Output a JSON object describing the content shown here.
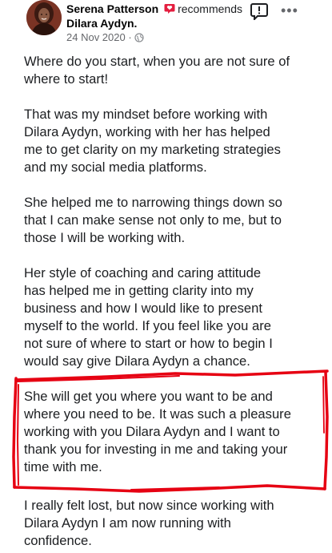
{
  "post": {
    "author": "Serena Patterson",
    "action": "recommends",
    "recommended": "Dilara Aydyn.",
    "date": "24 Nov 2020",
    "date_separator": "·",
    "icons": {
      "recommend": "recommend-badge-icon",
      "report": "report-icon",
      "more": "more-options-icon",
      "audience": "public-globe-icon"
    },
    "more_label": "•••",
    "paragraphs": [
      "Where do you start, when you are not sure of\nwhere to start!",
      "That was my mindset before working with\nDilara Aydyn, working with her has helped\nme to get clarity on my marketing strategies\nand my social media platforms.",
      "She helped me to narrowing things down so\nthat I can make sense not only to me, but to\nthose I will be working with.",
      "Her style of coaching and caring attitude\nhas helped me in getting clarity into my\nbusiness and how I would like to present\nmyself to the world. If you feel like you are\nnot sure of where to start or how to begin I\nwould say give Dilara Aydyn a chance.",
      "She will get you where you want to be and\nwhere you need to be. It was such a pleasure\nworking with you Dilara Aydyn and I want to\nthank you for investing in me and taking your\ntime with me.",
      "I really felt lost, but now since working with\nDilara Aydyn I am now running with\nconfidence."
    ]
  },
  "colors": {
    "accent_recommend": "#e41e3f",
    "highlight_marker": "#e60012",
    "meta_grey": "#65676b"
  }
}
